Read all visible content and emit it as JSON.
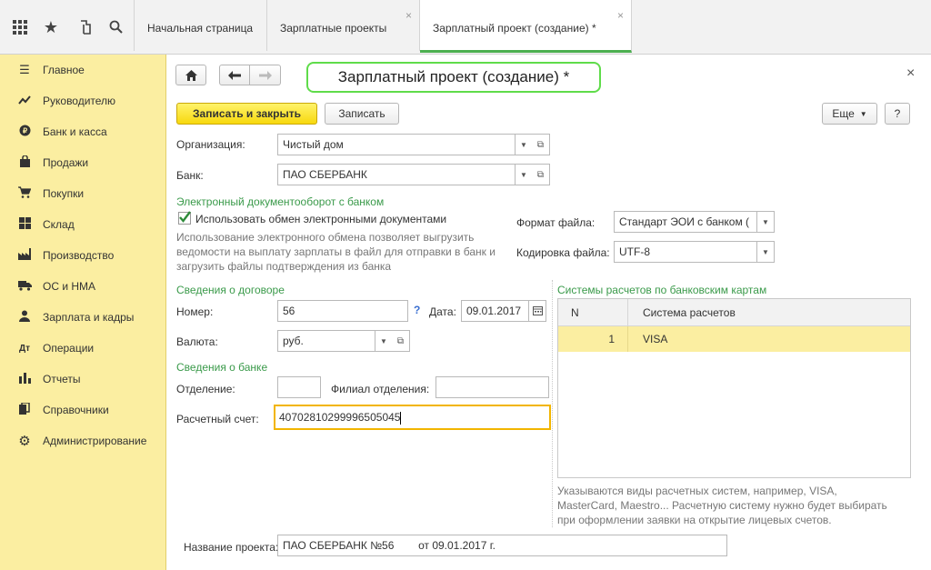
{
  "topbar": {
    "icons": [
      "apps-grid-icon",
      "star-icon",
      "history-icon",
      "search-icon"
    ],
    "tabs": [
      {
        "label": "Начальная страница",
        "closable": false
      },
      {
        "label": "Зарплатные проекты",
        "closable": true
      },
      {
        "label": "Зарплатный проект (создание) *",
        "closable": true,
        "active": true
      }
    ],
    "close_glyph": "×"
  },
  "sidebar": {
    "items": [
      {
        "label": "Главное",
        "icon": "menu-lines-icon"
      },
      {
        "label": "Руководителю",
        "icon": "trend-icon"
      },
      {
        "label": "Банк и касса",
        "icon": "coin-icon"
      },
      {
        "label": "Продажи",
        "icon": "bag-icon"
      },
      {
        "label": "Покупки",
        "icon": "cart-icon"
      },
      {
        "label": "Склад",
        "icon": "warehouse-icon"
      },
      {
        "label": "Производство",
        "icon": "factory-icon"
      },
      {
        "label": "ОС и НМА",
        "icon": "truck-icon"
      },
      {
        "label": "Зарплата и кадры",
        "icon": "person-icon"
      },
      {
        "label": "Операции",
        "icon": "operations-icon"
      },
      {
        "label": "Отчеты",
        "icon": "bar-chart-icon"
      },
      {
        "label": "Справочники",
        "icon": "books-icon"
      },
      {
        "label": "Администрирование",
        "icon": "gear-icon"
      }
    ]
  },
  "form": {
    "title": "Зарплатный проект (создание) *",
    "close_glyph": "×",
    "buttons": {
      "save_close": "Записать и закрыть",
      "save": "Записать",
      "more": "Еще",
      "help": "?"
    },
    "organization": {
      "label": "Организация:",
      "value": "Чистый дом"
    },
    "bank": {
      "label": "Банк:",
      "value": "ПАО СБЕРБАНК"
    },
    "edo": {
      "group_title": "Электронный документооборот с банком",
      "checkbox_label": "Использовать обмен электронными документами",
      "checked": true,
      "hint_lines": [
        "Использование электронного обмена позволяет выгрузить",
        "ведомости на выплату зарплаты в файл для отправки в банк и",
        "загрузить файлы подтверждения из банка"
      ],
      "file_format": {
        "label": "Формат файла:",
        "value": "Стандарт ЭОИ с банком ("
      },
      "encoding": {
        "label": "Кодировка файла:",
        "value": "UTF-8"
      }
    },
    "contract": {
      "group_title": "Сведения о договоре",
      "number": {
        "label": "Номер:",
        "value": "56",
        "help": "?"
      },
      "date": {
        "label": "Дата:",
        "value": "09.01.2017"
      },
      "currency": {
        "label": "Валюта:",
        "value": "руб."
      }
    },
    "bank_info": {
      "group_title": "Сведения о банке",
      "branch": {
        "label": "Отделение:",
        "value": ""
      },
      "sub_branch": {
        "label": "Филиал отделения:",
        "value": ""
      },
      "account": {
        "label": "Расчетный счет:",
        "value": "40702810299996505045"
      }
    },
    "card_systems": {
      "group_title": "Системы расчетов по банковским картам",
      "columns": [
        "N",
        "Система расчетов"
      ],
      "rows": [
        {
          "n": "1",
          "system": "VISA"
        }
      ],
      "hint_lines": [
        "Указываются виды расчетных систем, например, VISA,",
        "MasterCard, Maestro... Расчетную систему нужно будет выбирать",
        "при оформлении заявки на открытие лицевых счетов."
      ]
    },
    "project_name": {
      "label": "Название проекта:",
      "value": "ПАО СБЕРБАНК №56        от 09.01.2017 г."
    }
  },
  "colors": {
    "sidebar_bg": "#fbeea1",
    "accent_green": "#3a9a4a",
    "primary_button": "#f7d80e",
    "title_outline": "#5fdc4a"
  }
}
